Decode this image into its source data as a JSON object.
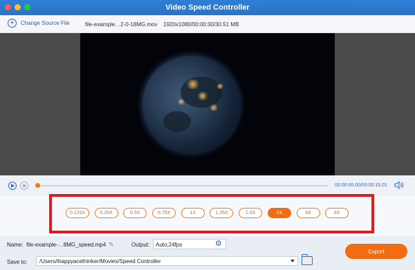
{
  "window": {
    "title": "Video Speed Controller"
  },
  "toolbar": {
    "change_source_label": "Change Source File",
    "file_name": "file-example…2-0-18MG.mov",
    "file_info": "1920x1080/00:00:30/30.51 MB"
  },
  "player": {
    "time_display": "00:00:00.00/00:00:15.01",
    "progress": 0
  },
  "speeds": {
    "options": [
      "0.125X",
      "0.25X",
      "0.5X",
      "0.75X",
      "1X",
      "1.25X",
      "1.5X",
      "2X",
      "4X",
      "8X"
    ],
    "selected": "2X"
  },
  "output": {
    "name_label": "Name:",
    "name_value": "file-example-…8MG_speed.mp4",
    "output_label": "Output:",
    "output_value": "Auto;24fps",
    "save_label": "Save to:",
    "save_path": "/Users/ihappyacethinker/Movies/Speed Controller",
    "export_label": "Export"
  },
  "colors": {
    "accent": "#f26c11",
    "titlebar": "#2f7fd6",
    "highlight": "#e11b1b"
  },
  "icons": [
    "close-dot-icon",
    "minimize-dot-icon",
    "zoom-dot-icon",
    "plus-circle-icon",
    "play-icon",
    "stop-icon",
    "volume-icon",
    "pencil-icon",
    "gear-icon",
    "dropdown-icon",
    "folder-icon"
  ]
}
